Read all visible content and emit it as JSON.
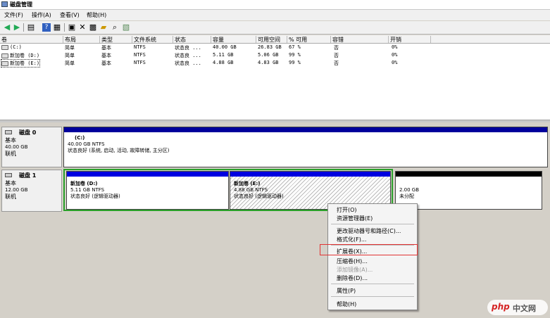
{
  "window": {
    "title": "磁盘管理"
  },
  "menu": [
    "文件(F)",
    "操作(A)",
    "查看(V)",
    "帮助(H)"
  ],
  "toolbar_icons": [
    "back-icon",
    "forward-icon",
    "console-tree-icon",
    "help-icon",
    "properties-icon",
    "refresh-icon",
    "delete-icon",
    "settings-icon",
    "open-icon",
    "search-icon",
    "export-icon"
  ],
  "columns": [
    "卷",
    "布局",
    "类型",
    "文件系统",
    "状态",
    "容量",
    "可用空间",
    "% 可用",
    "容错",
    "开销"
  ],
  "volumes": [
    {
      "name": "(C:)",
      "layout": "简单",
      "type": "基本",
      "fs": "NTFS",
      "status": "状态良 ...",
      "capacity": "40.00 GB",
      "free": "26.83 GB",
      "pct": "67 %",
      "fault": "否",
      "overhead": "0%"
    },
    {
      "name": "新加卷 (D:)",
      "layout": "简单",
      "type": "基本",
      "fs": "NTFS",
      "status": "状态良 ...",
      "capacity": "5.11 GB",
      "free": "5.06 GB",
      "pct": "99 %",
      "fault": "否",
      "overhead": "0%"
    },
    {
      "name": "新加卷 (E:)",
      "layout": "简单",
      "type": "基本",
      "fs": "NTFS",
      "status": "状态良 ...",
      "capacity": "4.88 GB",
      "free": "4.83 GB",
      "pct": "99 %",
      "fault": "否",
      "overhead": "0%"
    }
  ],
  "disks": [
    {
      "name": "磁盘 0",
      "type": "基本",
      "size": "40.00 GB",
      "state": "联机",
      "partitions": [
        {
          "title": "(C:)",
          "size": "40.00 GB NTFS",
          "status": "状态良好 (系统, 启动, 活动, 故障转储, 主分区)"
        }
      ]
    },
    {
      "name": "磁盘 1",
      "type": "基本",
      "size": "12.00 GB",
      "state": "联机",
      "partitions": [
        {
          "title": "新加卷  (D:)",
          "size": "5.11 GB NTFS",
          "status": "状态良好 (逻辑驱动器)"
        },
        {
          "title": "新加卷  (E:)",
          "size": "4.88 GB NTFS",
          "status": "状态良好 (逻辑驱动器)"
        },
        {
          "title": "",
          "size": "2.00 GB",
          "status": "未分配"
        }
      ]
    }
  ],
  "context_menu": [
    {
      "label": "打开(O)",
      "enabled": true
    },
    {
      "label": "资源管理器(E)",
      "enabled": true
    },
    {
      "label": "更改驱动器号和路径(C)...",
      "enabled": true
    },
    {
      "label": "格式化(F)...",
      "enabled": true
    },
    {
      "label": "扩展卷(X)...",
      "enabled": true
    },
    {
      "label": "压缩卷(H)...",
      "enabled": true
    },
    {
      "label": "添加镜像(A)...",
      "enabled": false
    },
    {
      "label": "删除卷(D)...",
      "enabled": true
    },
    {
      "label": "属性(P)",
      "enabled": true
    },
    {
      "label": "帮助(H)",
      "enabled": true
    }
  ],
  "watermark": {
    "brand": "php",
    "text": "中文网"
  },
  "colors": {
    "primary_bar": "#00009c",
    "logical_bar": "#0000e0",
    "unallocated_bar": "#000000",
    "extended_border": "#2aa02a",
    "highlight": "#e23333"
  }
}
